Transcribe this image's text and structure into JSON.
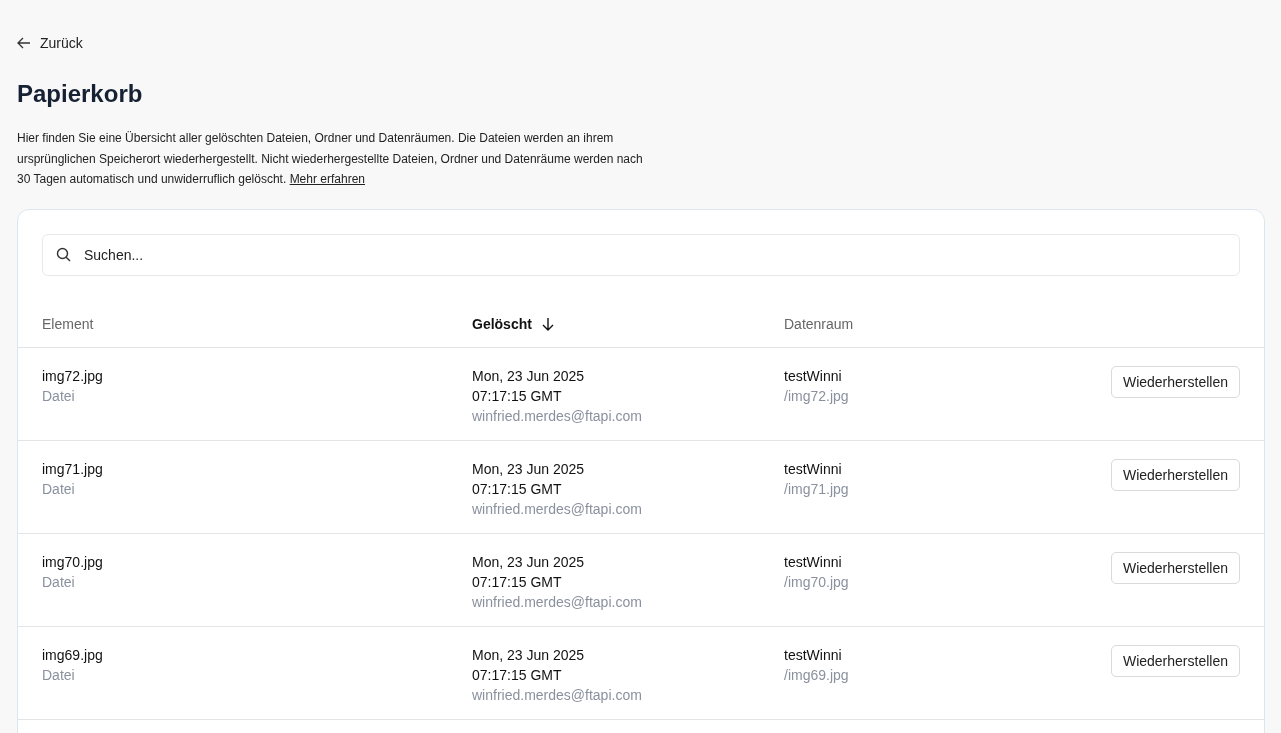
{
  "back_link": {
    "label": "Zurück"
  },
  "title": "Papierkorb",
  "description": "Hier finden Sie eine Übersicht aller gelöschten Dateien, Ordner und Datenräumen. Die Dateien werden an ihrem ursprünglichen Speicherort wiederhergestellt. Nicht wiederhergestellte Dateien, Ordner und Datenräume werden nach 30 Tagen automatisch und unwiderruflich gelöscht.",
  "description_link": "Mehr erfahren",
  "search": {
    "placeholder": "Suchen..."
  },
  "table": {
    "columns": [
      {
        "label": "Element",
        "sorted": false
      },
      {
        "label": "Gelöscht",
        "sorted": true
      },
      {
        "label": "Datenraum",
        "sorted": false
      }
    ],
    "rows": [
      {
        "name": "img72.jpg",
        "type": "Datei",
        "date": "Mon, 23 Jun 2025",
        "time": "07:17:15 GMT",
        "user": "winfried.merdes@ftapi.com",
        "room": "testWinni",
        "path": "/img72.jpg",
        "action": "Wiederherstellen"
      },
      {
        "name": "img71.jpg",
        "type": "Datei",
        "date": "Mon, 23 Jun 2025",
        "time": "07:17:15 GMT",
        "user": "winfried.merdes@ftapi.com",
        "room": "testWinni",
        "path": "/img71.jpg",
        "action": "Wiederherstellen"
      },
      {
        "name": "img70.jpg",
        "type": "Datei",
        "date": "Mon, 23 Jun 2025",
        "time": "07:17:15 GMT",
        "user": "winfried.merdes@ftapi.com",
        "room": "testWinni",
        "path": "/img70.jpg",
        "action": "Wiederherstellen"
      },
      {
        "name": "img69.jpg",
        "type": "Datei",
        "date": "Mon, 23 Jun 2025",
        "time": "07:17:15 GMT",
        "user": "winfried.merdes@ftapi.com",
        "room": "testWinni",
        "path": "/img69.jpg",
        "action": "Wiederherstellen"
      }
    ]
  }
}
